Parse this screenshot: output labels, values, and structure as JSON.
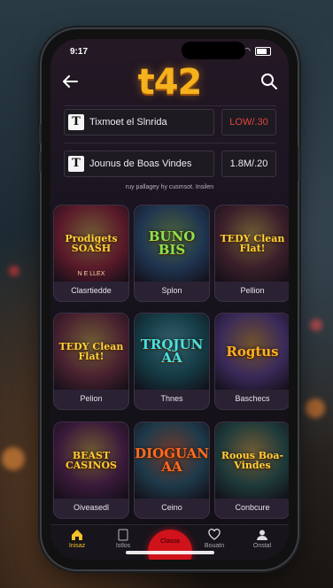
{
  "status": {
    "time": "9:17"
  },
  "header": {
    "logo": "t42"
  },
  "rows": [
    {
      "label": "Tixmoet el Slnrida",
      "value": "LOW/.30",
      "value_color": "#e0463a"
    },
    {
      "label": "Jounus de Boas Vindes",
      "value": "1.8M/.20",
      "value_color": "#f0eaf0"
    }
  ],
  "subtitle": "ruy pallagey hy cusmsot. Insilen",
  "games": [
    {
      "title": "Prodigets SOASH",
      "subtitle": "N E LLEX",
      "label": "Clasrtiedde",
      "bg": "#5a1a2a",
      "accent": "#ffcf3a"
    },
    {
      "title": "BUNO BIS",
      "subtitle": "",
      "label": "Splon",
      "bg": "#1f3550",
      "accent": "#8fe04a"
    },
    {
      "title": "TEDY Clean Flat!",
      "subtitle": "",
      "label": "Pellion",
      "bg": "#3a1f2a",
      "accent": "#ffd23a"
    },
    {
      "title": "TEDY Clean Flat!",
      "subtitle": "",
      "label": "Pelion",
      "bg": "#4a2230",
      "accent": "#ffd23a"
    },
    {
      "title": "TRQJUN AA",
      "subtitle": "",
      "label": "Thnes",
      "bg": "#143a44",
      "accent": "#4ae0e0"
    },
    {
      "title": "Rogtus",
      "subtitle": "",
      "label": "Baschecs",
      "bg": "#3a2a5a",
      "accent": "#ffb020"
    },
    {
      "title": "BEAST CASINOS",
      "subtitle": "",
      "label": "Oiveasedl",
      "bg": "#3a1a3a",
      "accent": "#ffcc33"
    },
    {
      "title": "DIOGUAN AA",
      "subtitle": "",
      "label": "Ceino",
      "bg": "#1e3a4a",
      "accent": "#ff6a20"
    },
    {
      "title": "Roous Boa-Vindes",
      "subtitle": "",
      "label": "Conbcure",
      "bg": "#1e3a3a",
      "accent": "#ffcf3a"
    }
  ],
  "tabs": [
    {
      "label": "Inisaz",
      "icon": "home-icon",
      "glyph": "⌂",
      "active": true
    },
    {
      "label": "Istlos",
      "icon": "document-icon",
      "glyph": "▯",
      "active": false
    },
    {
      "label": "Clasoa",
      "icon": "play-icon",
      "glyph": "",
      "active": false
    },
    {
      "label": "Bouatn",
      "icon": "heart-icon",
      "glyph": "♡",
      "active": false
    },
    {
      "label": "Onstal",
      "icon": "user-icon",
      "glyph": "●",
      "active": false
    }
  ]
}
